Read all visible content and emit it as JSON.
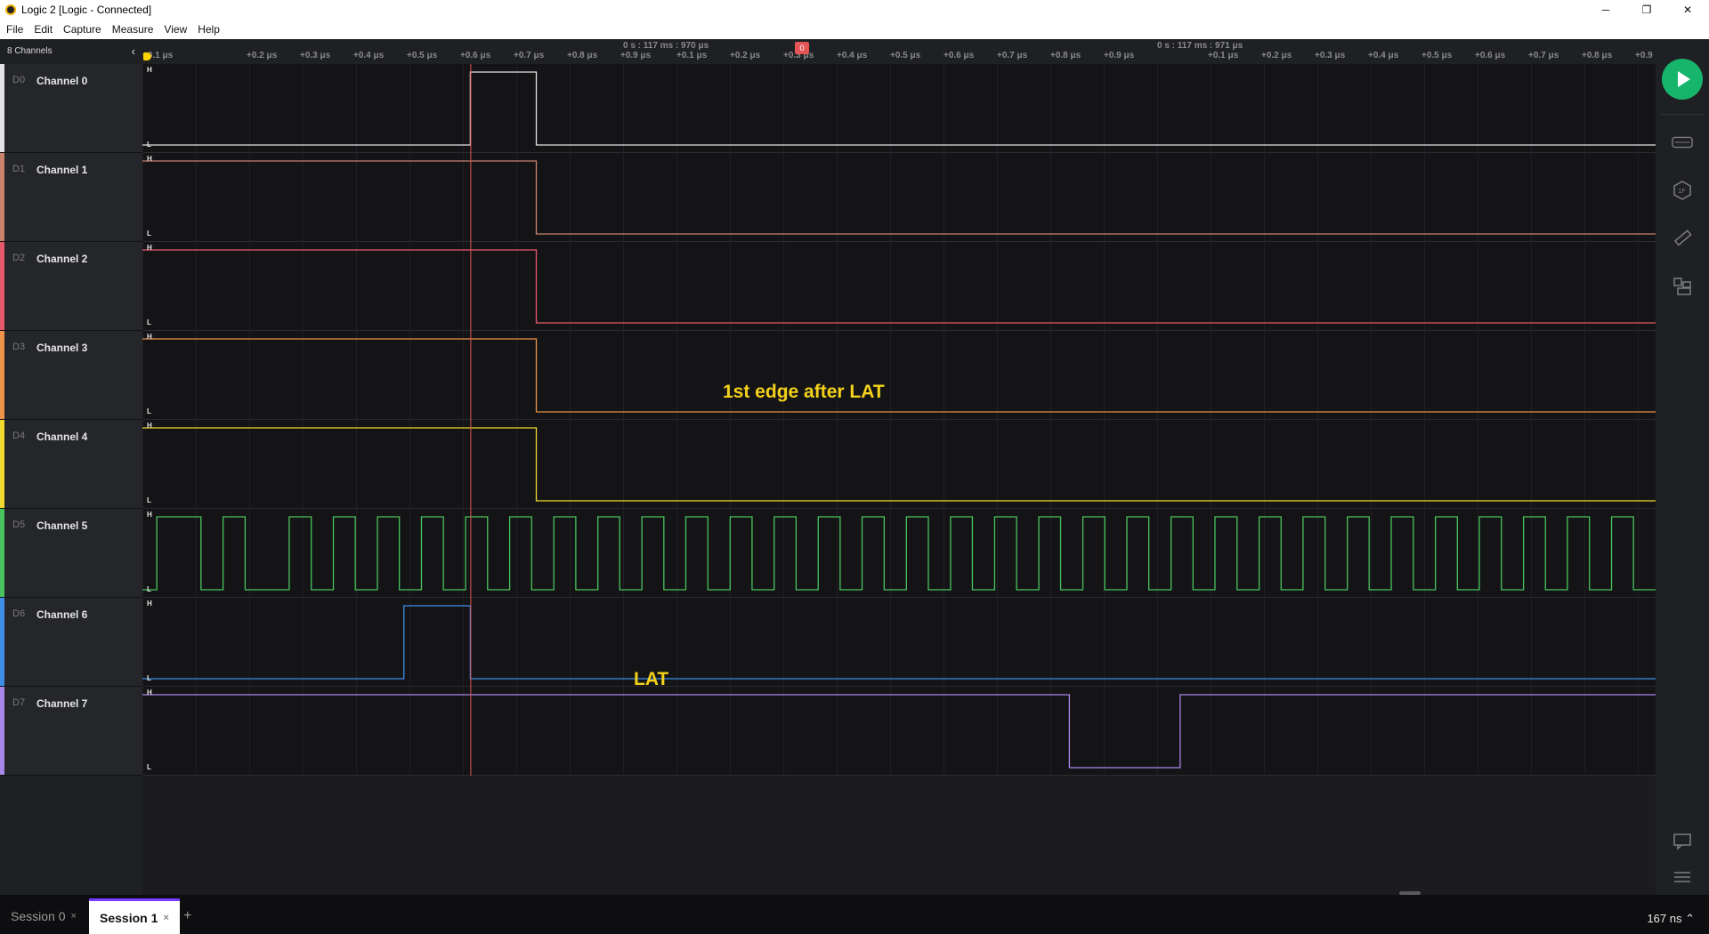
{
  "window": {
    "title": "Logic 2 [Logic - Connected]",
    "minimize": "─",
    "maximize": "❐",
    "close": "✕"
  },
  "menu": [
    "File",
    "Edit",
    "Capture",
    "Measure",
    "View",
    "Help"
  ],
  "sidebar": {
    "header": "8 Channels",
    "collapse_icon": "chevron-left",
    "channels": [
      {
        "id": "D0",
        "name": "Channel 0",
        "color": "#e3e3e3"
      },
      {
        "id": "D1",
        "name": "Channel 1",
        "color": "#c8826d"
      },
      {
        "id": "D2",
        "name": "Channel 2",
        "color": "#e6596a"
      },
      {
        "id": "D3",
        "name": "Channel 3",
        "color": "#ee9349"
      },
      {
        "id": "D4",
        "name": "Channel 4",
        "color": "#f2da2f"
      },
      {
        "id": "D5",
        "name": "Channel 5",
        "color": "#49c35e"
      },
      {
        "id": "D6",
        "name": "Channel 6",
        "color": "#3f8ee9"
      },
      {
        "id": "D7",
        "name": "Channel 7",
        "color": "#a986e9"
      }
    ]
  },
  "ruler": {
    "ref_left": "0 s : 117 ms : 970 μs",
    "ref_right": "0 s : 117 ms : 971 μs",
    "ticks_a": [
      "+0.1 μs",
      "+0.2 μs",
      "+0.3 μs",
      "+0.4 μs",
      "+0.5 μs",
      "+0.6 μs",
      "+0.7 μs",
      "+0.8 μs",
      "+0.9 μs"
    ],
    "ticks_b": [
      "+0.1 μs",
      "+0.2 μs",
      "+0.3 μs",
      "+0.4 μs",
      "+0.5 μs",
      "+0.6 μs",
      "+0.7 μs",
      "+0.8 μs",
      "+0.9 μs"
    ],
    "ticks_c": [
      "+0.1 μs",
      "+0.2 μs",
      "+0.3 μs",
      "+0.4 μs",
      "+0.5 μs",
      "+0.6 μs",
      "+0.7 μs",
      "+0.8 μs",
      "+0.9"
    ],
    "marker_label": "0",
    "marker_color": "#e45656"
  },
  "levels": {
    "high": "H",
    "low": "L"
  },
  "annotations": {
    "edge": "1st edge after LAT",
    "lat": "LAT",
    "color": "#f4d21b"
  },
  "signals": {
    "D0": [
      [
        0,
        0
      ],
      [
        0.2167,
        1
      ],
      [
        0.2603,
        0
      ]
    ],
    "D1": [
      [
        0,
        1
      ],
      [
        0.2603,
        0
      ]
    ],
    "D2": [
      [
        0,
        1
      ],
      [
        0.2603,
        0
      ]
    ],
    "D3": [
      [
        0,
        1
      ],
      [
        0.2603,
        0
      ]
    ],
    "D4": [
      [
        0,
        1
      ],
      [
        0.2603,
        0
      ]
    ],
    "D5_edges": [
      0.0095,
      0.0387,
      0.0533,
      0.0679,
      0.097,
      0.1116,
      0.1262,
      0.1407,
      0.1553,
      0.1698,
      0.1844,
      0.1989,
      0.2136,
      0.2281,
      0.2427,
      0.2572,
      0.2719,
      0.2864,
      0.301,
      0.3154,
      0.3301,
      0.3446,
      0.3591,
      0.3737,
      0.3884,
      0.4029,
      0.4175,
      0.432,
      0.4466,
      0.4611,
      0.4756,
      0.4902,
      0.5049,
      0.5194,
      0.5341,
      0.5485,
      0.5632,
      0.5777,
      0.5924,
      0.6068,
      0.6215,
      0.636,
      0.6506,
      0.6651,
      0.6798,
      0.6943,
      0.7088,
      0.7234,
      0.738,
      0.7525,
      0.767,
      0.7816,
      0.7963,
      0.8107,
      0.8253,
      0.8399,
      0.8545,
      0.869,
      0.8835,
      0.8981,
      0.9127,
      0.9272,
      0.9417,
      0.9563,
      0.9709,
      0.9854
    ],
    "D5_start": 0,
    "D6": [
      [
        0,
        0
      ],
      [
        0.1728,
        1
      ],
      [
        0.2167,
        0
      ]
    ],
    "D7": [
      [
        0,
        1
      ],
      [
        0.6126,
        0
      ],
      [
        0.6858,
        1
      ]
    ]
  },
  "cursor_position": 0.2167,
  "right_rail": {
    "play": "play-icon",
    "icons": [
      "analyzers-icon",
      "extensions-icon",
      "measure-icon",
      "layout-icon",
      "notes-icon",
      "menu-icon"
    ]
  },
  "sessions": [
    {
      "label": "Session 0",
      "active": false
    },
    {
      "label": "Session 1",
      "active": true
    }
  ],
  "add_tab": "+",
  "zoom_level": "167 ns ⌃"
}
